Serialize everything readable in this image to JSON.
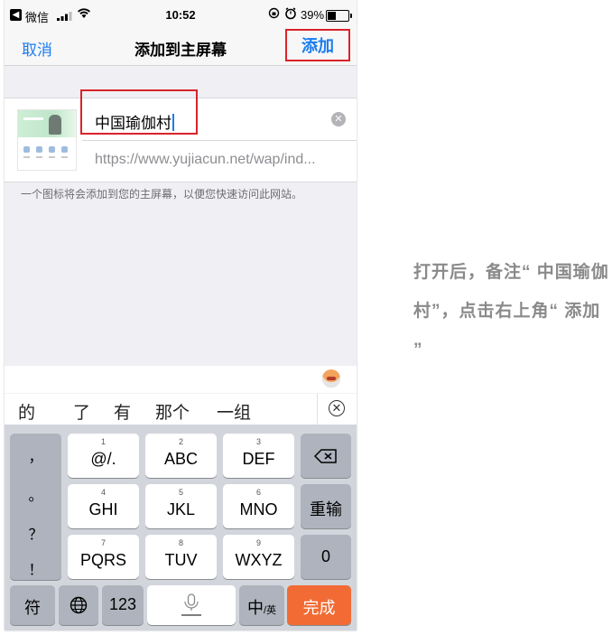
{
  "status_bar": {
    "back_app": "微信",
    "time": "10:52",
    "battery_pct": "39%",
    "battery_level": 0.39
  },
  "nav": {
    "cancel": "取消",
    "title": "添加到主屏幕",
    "add": "添加"
  },
  "form": {
    "name_value": "中国瑜伽村",
    "url_value": "https://www.yujiacun.net/wap/ind...",
    "hint": "一个图标将会添加到您的主屏幕，以便您快速访问此网站。"
  },
  "candidates": [
    "的",
    "了",
    "有",
    "那个",
    "一组"
  ],
  "keyboard": {
    "punct": [
      "，",
      "。",
      "？",
      "！"
    ],
    "rows": [
      [
        {
          "sub": "1",
          "main": "@/."
        },
        {
          "sub": "2",
          "main": "ABC"
        },
        {
          "sub": "3",
          "main": "DEF"
        }
      ],
      [
        {
          "sub": "4",
          "main": "GHI"
        },
        {
          "sub": "5",
          "main": "JKL"
        },
        {
          "sub": "6",
          "main": "MNO"
        }
      ],
      [
        {
          "sub": "7",
          "main": "PQRS"
        },
        {
          "sub": "8",
          "main": "TUV"
        },
        {
          "sub": "9",
          "main": "WXYZ"
        }
      ]
    ],
    "reenter": "重输",
    "zero": "0",
    "symbols": "符",
    "num": "123",
    "lang_main": "中",
    "lang_sub": "/英",
    "done": "完成"
  },
  "annotation": "打开后，备注“ 中国瑜伽村”，点击右上角“ 添加 ”",
  "colors": {
    "ios_blue": "#1a7cf0",
    "highlight_red": "#d9232b",
    "done_orange": "#f26b34"
  },
  "icons": [
    "back-app-icon",
    "signal-icon",
    "wifi-icon",
    "orientation-lock-icon",
    "alarm-icon",
    "battery-icon",
    "clear-text-icon",
    "globe-icon",
    "microphone-icon",
    "backspace-icon",
    "close-candidates-icon"
  ]
}
